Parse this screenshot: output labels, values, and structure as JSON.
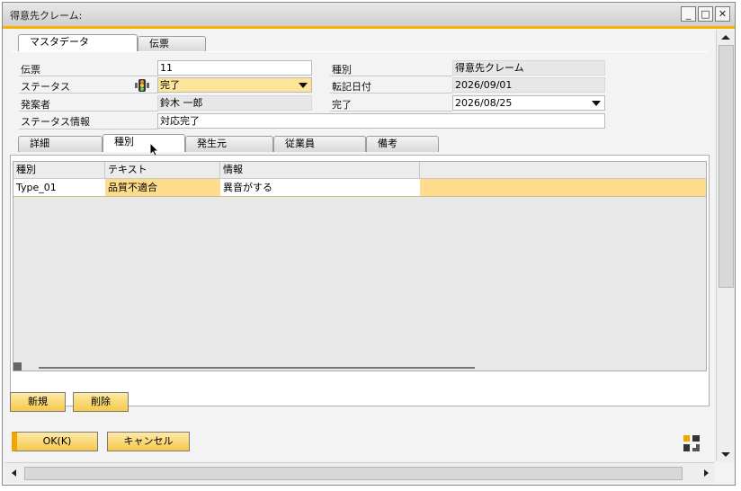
{
  "window": {
    "title": "得意先クレーム:"
  },
  "top_tabs": [
    {
      "label": "マスタデータ"
    },
    {
      "label": "伝票"
    }
  ],
  "header": {
    "doc_label": "伝票",
    "doc_value": "11",
    "status_label": "ステータス",
    "status_value": "完了",
    "creator_label": "発案者",
    "creator_value": "鈴木 一郎",
    "status_info_label": "ステータス情報",
    "status_info_value": "対応完了",
    "type_label": "種別",
    "type_value": "得意先クレーム",
    "posting_date_label": "転記日付",
    "posting_date_value": "2026/09/01",
    "done_label": "完了",
    "done_value": "2026/08/25"
  },
  "sub_tabs": [
    {
      "label": "詳細"
    },
    {
      "label": "種別"
    },
    {
      "label": "発生元"
    },
    {
      "label": "従業員"
    },
    {
      "label": "備考"
    }
  ],
  "grid": {
    "columns": [
      "種別",
      "テキスト",
      "情報"
    ],
    "rows": [
      {
        "type": "Type_01",
        "text": "品質不適合",
        "info": "異音がする"
      }
    ]
  },
  "buttons": {
    "new": "新規",
    "delete": "削除",
    "ok": "OK(K)",
    "cancel": "キャンセル"
  },
  "colors": {
    "accent": "#f5b301",
    "row_highlight": "#fddc8c"
  }
}
